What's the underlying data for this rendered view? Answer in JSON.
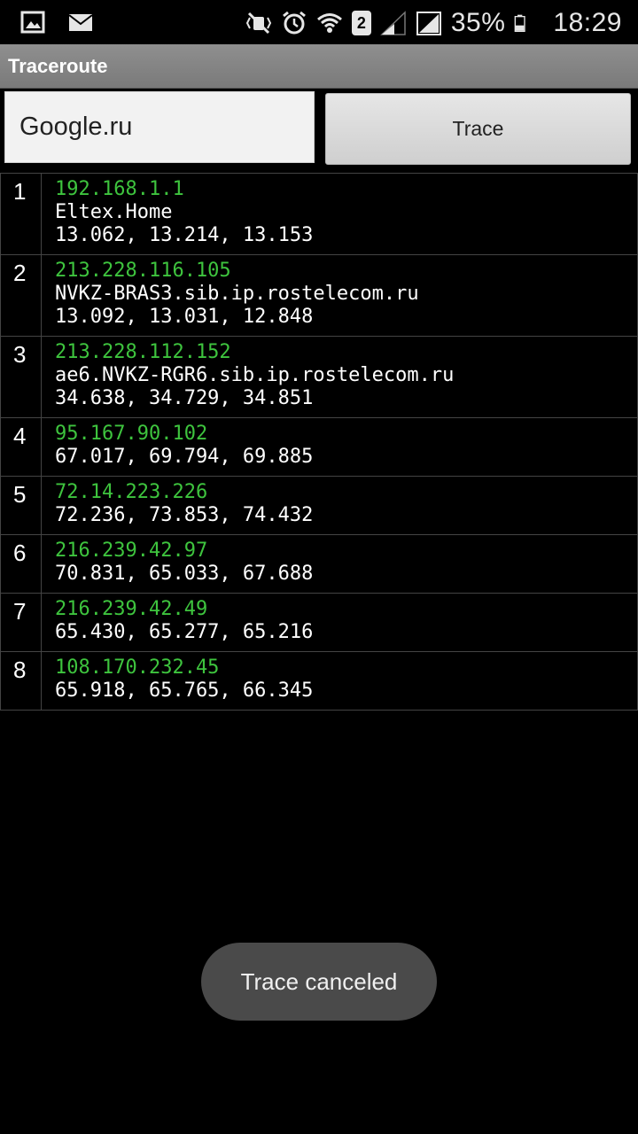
{
  "status_bar": {
    "icons_left": [
      "gallery-icon",
      "email-icon"
    ],
    "icons_right": [
      "mute-icon",
      "alarm-icon",
      "wifi-icon",
      "sim-icon",
      "signal-icon",
      "signal-full-icon",
      "battery-icon"
    ],
    "sim_label": "2",
    "battery": "35%",
    "time": "18:29"
  },
  "app": {
    "title": "Traceroute"
  },
  "controls": {
    "host_value": "Google.ru",
    "trace_label": "Trace"
  },
  "hops": [
    {
      "num": "1",
      "ip": "192.168.1.1",
      "host": "Eltex.Home",
      "times": "13.062, 13.214, 13.153"
    },
    {
      "num": "2",
      "ip": "213.228.116.105",
      "host": "NVKZ-BRAS3.sib.ip.rostelecom.ru",
      "times": "13.092, 13.031, 12.848"
    },
    {
      "num": "3",
      "ip": "213.228.112.152",
      "host": "ae6.NVKZ-RGR6.sib.ip.rostelecom.ru",
      "times": "34.638, 34.729, 34.851"
    },
    {
      "num": "4",
      "ip": "95.167.90.102",
      "host": "",
      "times": "67.017, 69.794, 69.885"
    },
    {
      "num": "5",
      "ip": "72.14.223.226",
      "host": "",
      "times": "72.236, 73.853, 74.432"
    },
    {
      "num": "6",
      "ip": "216.239.42.97",
      "host": "",
      "times": "70.831, 65.033, 67.688"
    },
    {
      "num": "7",
      "ip": "216.239.42.49",
      "host": "",
      "times": "65.430, 65.277, 65.216"
    },
    {
      "num": "8",
      "ip": "108.170.232.45",
      "host": "",
      "times": "65.918, 65.765, 66.345"
    }
  ],
  "toast": {
    "text": "Trace canceled"
  }
}
